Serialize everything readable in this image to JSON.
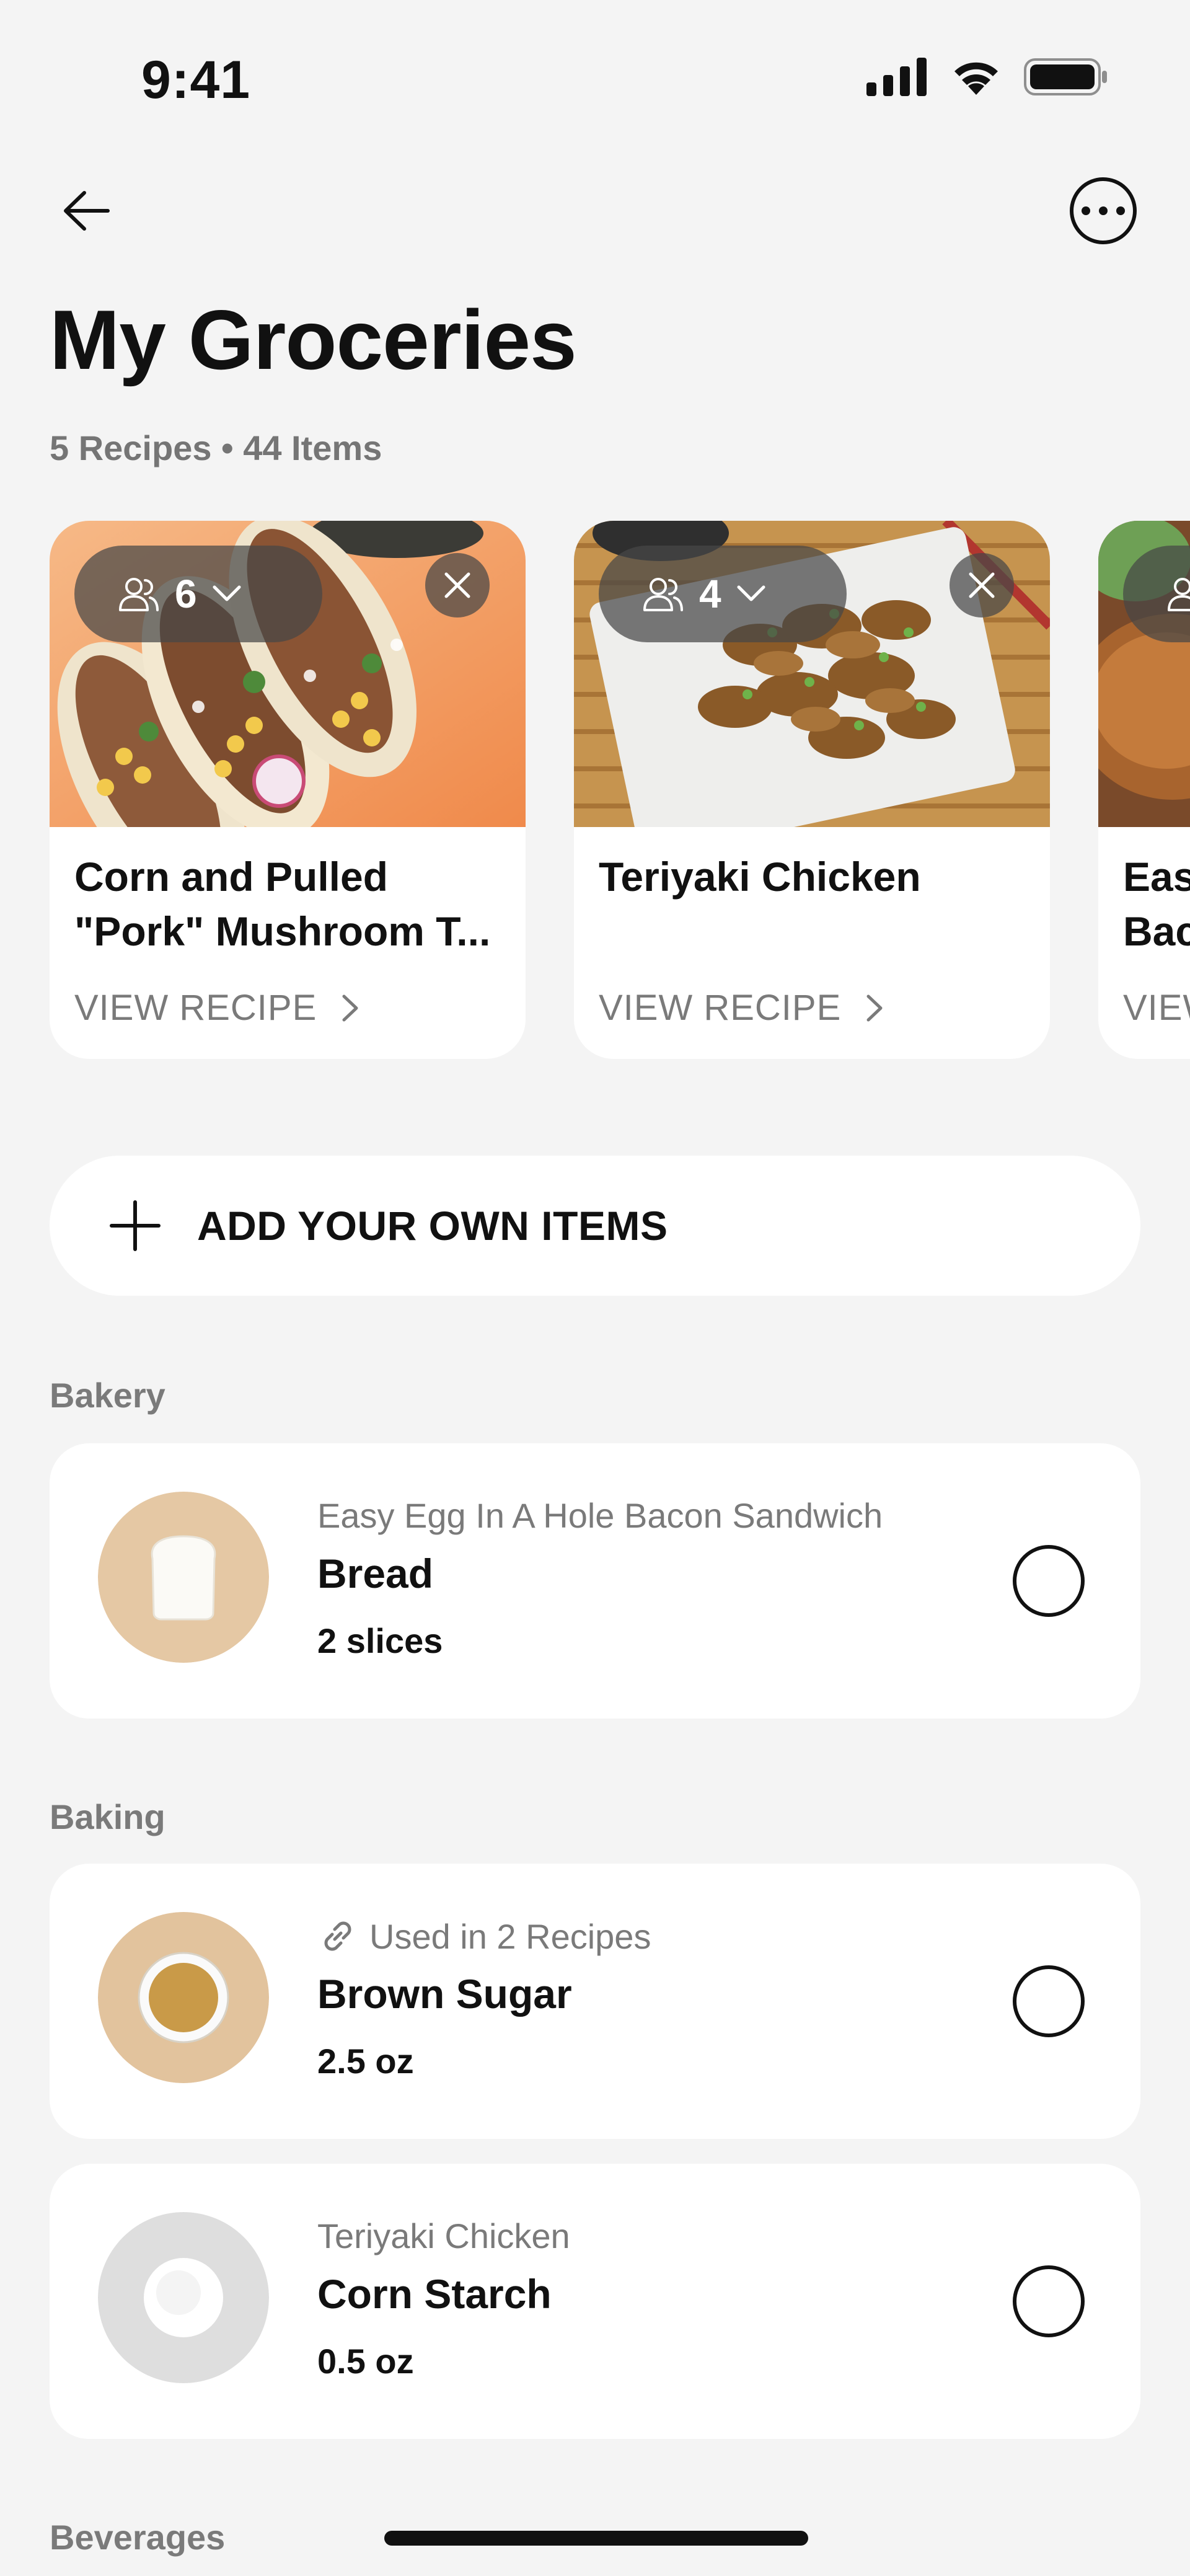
{
  "status": {
    "time": "9:41"
  },
  "header": {
    "title": "My Groceries",
    "subtitle": "5 Recipes • 44 Items"
  },
  "recipes": [
    {
      "servings": "6",
      "title": "Corn and Pulled \"Pork\" Mushroom T...",
      "link": "VIEW RECIPE"
    },
    {
      "servings": "4",
      "title": "Teriyaki Chicken",
      "link": "VIEW RECIPE"
    },
    {
      "servings": "",
      "title": "Eas Bac",
      "link": "VIEW"
    }
  ],
  "add_items": {
    "label": "ADD YOUR OWN ITEMS"
  },
  "sections": [
    {
      "label": "Bakery",
      "items": [
        {
          "meta": "Easy Egg In A Hole Bacon Sandwich",
          "name": "Bread",
          "qty": "2 slices",
          "thumb_color": "#e5c8a4"
        }
      ]
    },
    {
      "label": "Baking",
      "items": [
        {
          "meta": "Used in 2 Recipes",
          "name": "Brown Sugar",
          "qty": "2.5 oz",
          "thumb_color": "#e2c39d"
        },
        {
          "meta": "Teriyaki Chicken",
          "name": "Corn Starch",
          "qty": "0.5 oz",
          "thumb_color": "#dedede"
        }
      ]
    },
    {
      "label": "Beverages",
      "items": []
    }
  ],
  "colors": {
    "background": "#f4f4f4",
    "card": "#ffffff",
    "muted_text": "#7a7a7a",
    "text": "#111111"
  }
}
